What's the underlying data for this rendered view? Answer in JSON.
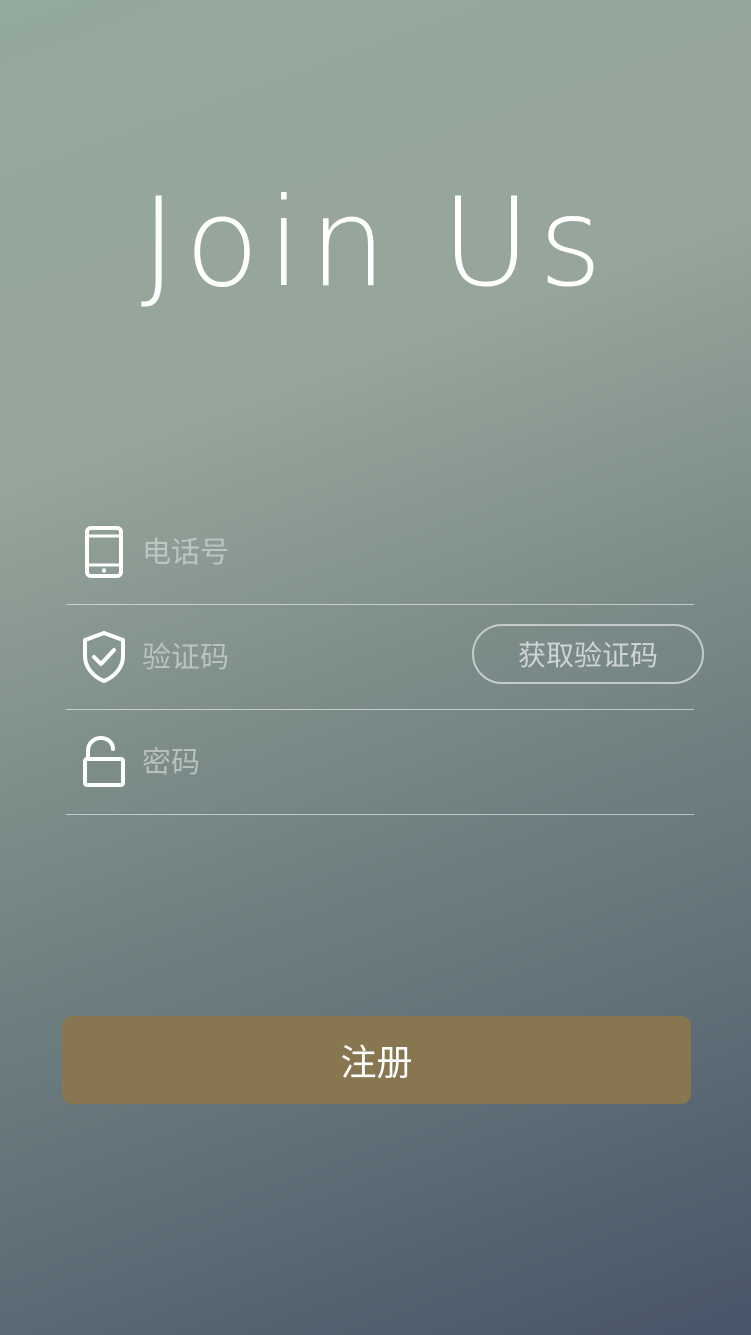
{
  "header": {
    "title": "Join Us"
  },
  "form": {
    "phone": {
      "placeholder": "电话号",
      "icon": "phone-icon"
    },
    "code": {
      "placeholder": "验证码",
      "icon": "shield-check-icon",
      "button_label": "获取验证码"
    },
    "password": {
      "placeholder": "密码",
      "icon": "unlock-icon"
    }
  },
  "actions": {
    "register_label": "注册"
  },
  "colors": {
    "register_button": "#87764f",
    "gradient_top": "#93a99c",
    "gradient_bottom": "#485468"
  }
}
